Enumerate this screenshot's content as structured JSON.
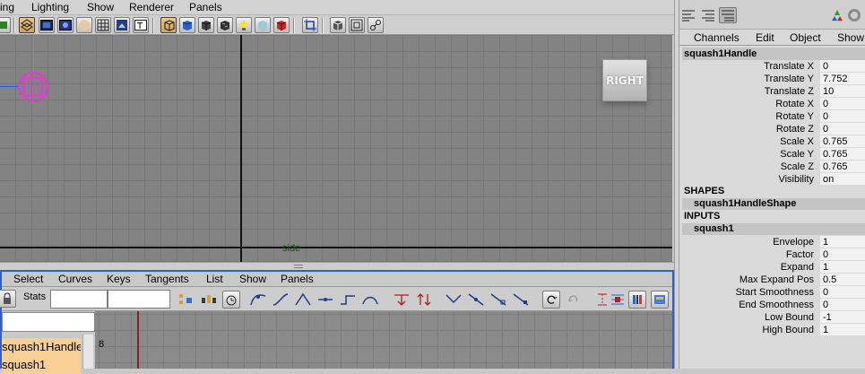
{
  "viewport": {
    "menu": [
      "ing",
      "Lighting",
      "Show",
      "Renderer",
      "Panels"
    ],
    "view_label": "side",
    "view_cube_label": "RIGHT"
  },
  "graph_editor": {
    "menu": [
      "Select",
      "Curves",
      "Keys",
      "Tangents",
      "List",
      "Show",
      "Panels"
    ],
    "stats_label": "Stats",
    "outliner_items": [
      "squash1Handle",
      "squash1"
    ],
    "graph_y_label": "8"
  },
  "channel_box": {
    "menu": [
      "Channels",
      "Edit",
      "Object",
      "Show"
    ],
    "node_title": "squash1Handle",
    "transform_attrs": [
      {
        "name": "Translate X",
        "value": "0"
      },
      {
        "name": "Translate Y",
        "value": "7.752"
      },
      {
        "name": "Translate Z",
        "value": "10"
      },
      {
        "name": "Rotate X",
        "value": "0"
      },
      {
        "name": "Rotate Y",
        "value": "0"
      },
      {
        "name": "Rotate Z",
        "value": "0"
      },
      {
        "name": "Scale X",
        "value": "0.765"
      },
      {
        "name": "Scale Y",
        "value": "0.765"
      },
      {
        "name": "Scale Z",
        "value": "0.765"
      },
      {
        "name": "Visibility",
        "value": "on"
      }
    ],
    "shapes_header": "SHAPES",
    "shape_node": "squash1HandleShape",
    "inputs_header": "INPUTS",
    "input_node": "squash1",
    "input_attrs": [
      {
        "name": "Envelope",
        "value": "1"
      },
      {
        "name": "Factor",
        "value": "0"
      },
      {
        "name": "Expand",
        "value": "1"
      },
      {
        "name": "Max Expand Pos",
        "value": "0.5"
      },
      {
        "name": "Start Smoothness",
        "value": "0"
      },
      {
        "name": "End Smoothness",
        "value": "0"
      },
      {
        "name": "Low Bound",
        "value": "-1"
      },
      {
        "name": "High Bound",
        "value": "1"
      }
    ]
  },
  "colors": {
    "selection_magenta": "#e33ad0",
    "active_panel_border": "#2a62c9",
    "outliner_highlight": "#f8cf94",
    "viewport_bg": "#838383"
  }
}
